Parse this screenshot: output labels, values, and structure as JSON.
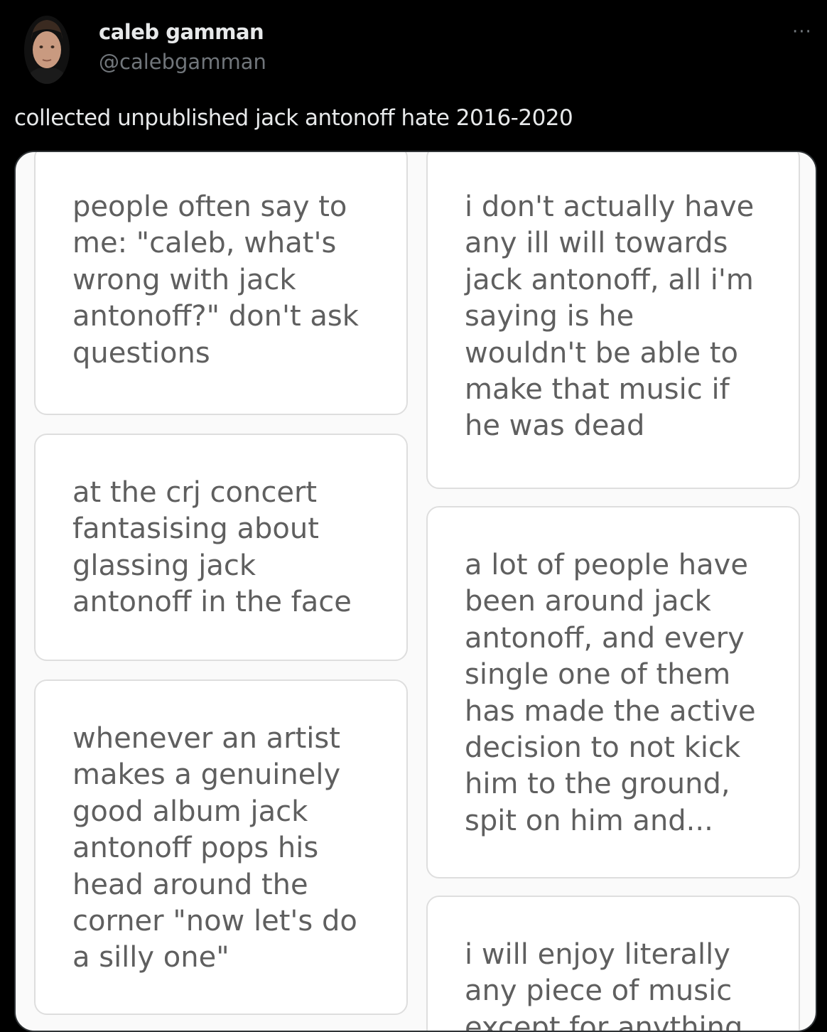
{
  "tweet": {
    "author": {
      "display_name": "caleb gamman",
      "handle": "@calebgamman",
      "avatar_icon": "avatar-portrait"
    },
    "more_label": "···",
    "text": "collected unpublished jack antonoff hate 2016-2020"
  },
  "media": {
    "left_column": [
      {
        "text": "people often say to\nme: \"caleb, what's\nwrong with jack\nantonoff?\" don't ask\nquestions"
      },
      {
        "text": "at the crj concert\nfantasising about\nglassing jack\nantonoff in the face"
      },
      {
        "text": "whenever an artist\nmakes a genuinely\ngood album jack\nantonoff pops his\nhead around the\ncorner \"now let's do\na silly one\""
      }
    ],
    "right_column": [
      {
        "text": "i don't actually have\nany ill will towards\njack antonoff, all i'm\nsaying is he\nwouldn't be able to\nmake that music if\nhe was dead"
      },
      {
        "text": "a lot of people have\nbeen around jack\nantonoff, and every\nsingle one of them\nhas made the active\ndecision to not kick\nhim to the ground,\nspit on him and..."
      },
      {
        "text": "i will enjoy literally\nany piece of music\nexcept for anything"
      }
    ]
  },
  "colors": {
    "background": "#000000",
    "primary_text": "#e7e9ea",
    "secondary_text": "#71767b",
    "card_text": "#5f5f5f"
  }
}
